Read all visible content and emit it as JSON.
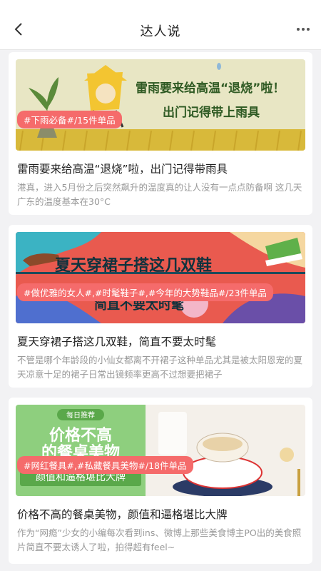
{
  "header": {
    "title": "达人说",
    "back_icon": "chevron-left-icon",
    "more_icon": "more-dots-icon"
  },
  "articles": [
    {
      "banner_line1": "雷雨要来给高温“退烧”啦！",
      "banner_line2": "出门记得带上雨具",
      "tag": "#下雨必备#/15件单品",
      "title": "雷雨要来给高温“退烧”啦，出门记得带雨具",
      "desc": "港真，进入5月份之后突然飙升的温度真的让人没有一点点防备啊 这几天广东的温度基本在30°C"
    },
    {
      "banner_line1": "夏天穿裙子搭这几双鞋",
      "banner_line2": "简直不要太时髦",
      "tag": "#做优雅的女人#,#时髦鞋子#,#今年的大势鞋品#/23件单品",
      "title": "夏天穿裙子搭这几双鞋，简直不要太时髦",
      "desc": "不管是哪个年龄段的小仙女都离不开裙子这种单品尤其是被太阳恩宠的夏天凉意十足的裙子日常出镜频率更高不过想要把裙子"
    },
    {
      "banner_badge": "每日推荐",
      "banner_line1": "价格不高",
      "banner_line2": "的餐桌美物",
      "banner_line3": "颜值和逼格堪比大牌",
      "tag": "#网红餐具#,#私藏餐具美物#/18件单品",
      "title": "价格不高的餐桌美物，颜值和逼格堪比大牌",
      "desc": "作为“网瘾”少女的小编每次看到ins、微博上那些美食博主PO出的美食照片简直不要太诱人了啦，拍得超有feel~"
    }
  ],
  "colors": {
    "tag_bg": "#f56b6b",
    "banner1_bg": "#e8e6c4",
    "banner2_bg": "#e95a4f",
    "banner3_left": "#8ecf7e"
  }
}
